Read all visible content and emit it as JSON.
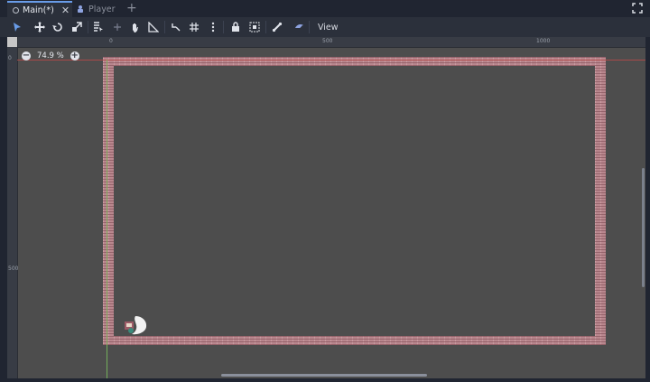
{
  "tabs": [
    {
      "label": "Main(*)",
      "active": true
    },
    {
      "label": "Player",
      "active": false
    }
  ],
  "toolbar": {
    "view_label": "View",
    "tools": [
      "select-icon",
      "move-icon",
      "rotate-icon",
      "scale-icon",
      "list-select-icon",
      "pivot-icon",
      "pan-icon",
      "ruler-icon",
      "smart-snap-icon",
      "grid-snap-icon",
      "more-options-icon",
      "lock-icon",
      "group-icon",
      "bone-icon",
      "skeleton-icon"
    ]
  },
  "viewport": {
    "zoom_label": "74.9 %",
    "ruler_h": [
      "0",
      "500",
      "1000"
    ],
    "ruler_v": [
      "0",
      "500"
    ]
  },
  "colors": {
    "accent": "#699ce8",
    "viewport_bg": "#4d4d4d",
    "brick": "#b9878e"
  }
}
